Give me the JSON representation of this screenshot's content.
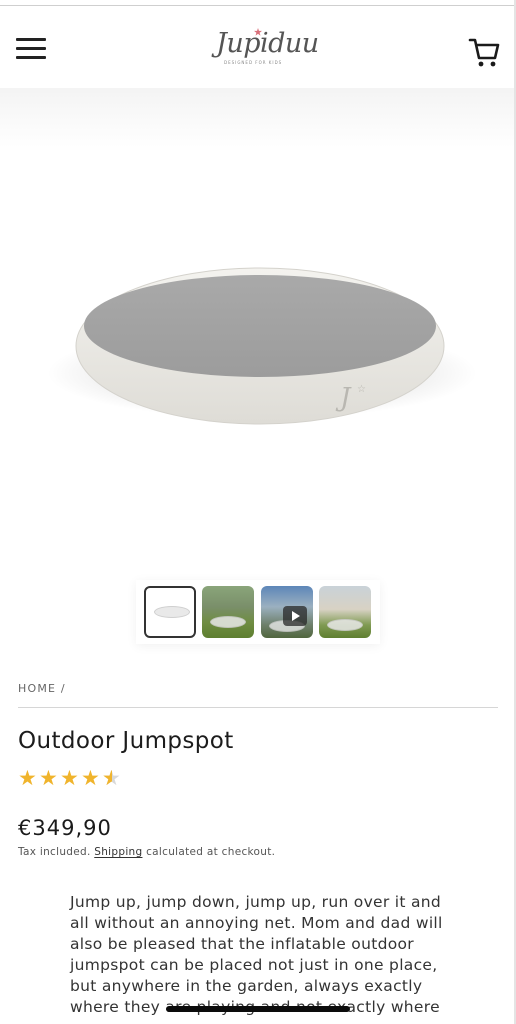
{
  "header": {
    "logo_text": "Jupiduu",
    "logo_tagline": "designed for kids"
  },
  "colors": {
    "rating_star": "#f0b42c",
    "divider": "#d6d6d6",
    "text": "#1c1c1c"
  },
  "icons": {
    "menu": "hamburger-icon",
    "cart": "cart-icon",
    "play": "play-icon",
    "star": "star-icon"
  },
  "gallery": {
    "thumbnails": [
      "product",
      "garden",
      "video",
      "villa"
    ],
    "active_index": 0
  },
  "breadcrumb": {
    "text": "HOME /"
  },
  "product": {
    "title": "Outdoor Jumpspot",
    "rating": 4.5,
    "rating_max": 5,
    "price": "€349,90",
    "tax_prefix": "Tax included.",
    "shipping_link": "Shipping",
    "tax_suffix": "calculated at checkout.",
    "description": "Jump up, jump down, jump up, run over it and all without an annoying net. Mom and dad will also be pleased that the inflatable outdoor jumpspot can be placed not just in one place, but anywhere in the garden, always exactly where they are playing and not exactly where"
  }
}
